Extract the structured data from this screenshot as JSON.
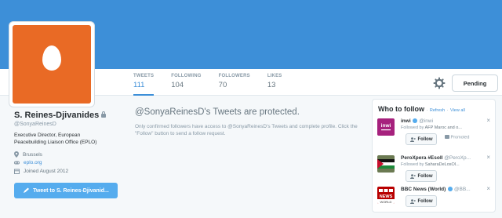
{
  "profile": {
    "name": "S. Reines-Djivanides",
    "handle": "@SonyaReinesD",
    "bio": "Executive Director, European Peacebuilding Liaison Office (EPLO)",
    "location": "Brussels",
    "website": "eplo.org",
    "joined": "Joined August 2012",
    "tweet_button": "Tweet to S. Reines-Djivanid...",
    "avatar_color": "#e96a25"
  },
  "stats": [
    {
      "label": "TWEETS",
      "value": "111"
    },
    {
      "label": "FOLLOWING",
      "value": "104"
    },
    {
      "label": "FOLLOWERS",
      "value": "70"
    },
    {
      "label": "LIKES",
      "value": "13"
    }
  ],
  "actions": {
    "pending_label": "Pending"
  },
  "protected": {
    "title": "@SonyaReinesD's Tweets are protected.",
    "text": "Only confirmed followers have access to @SonyaReinesD's Tweets and complete profile. Click the \"Follow\" button to send a follow request."
  },
  "who_to_follow": {
    "title": "Who to follow",
    "sep": "·",
    "refresh": "Refresh",
    "view_all": "View all",
    "follow_label": "Follow",
    "close": "×",
    "suggestions": [
      {
        "name": "inwi",
        "handle": "@inwi",
        "context_prefix": "Followed by",
        "context": "AFP Maroc and o...",
        "promoted": "Promoted",
        "pic": "inwi"
      },
      {
        "name": "PeroXpera #Esoll",
        "handle": "@PeroXp...",
        "context_prefix": "Followed by",
        "context": "SaharaDeLosOl...",
        "promoted": "",
        "pic": "flag"
      },
      {
        "name": "BBC News (World)",
        "handle": "@BB...",
        "context_prefix": "",
        "context": "",
        "promoted": "",
        "pic": "bbc"
      }
    ]
  },
  "colors": {
    "banner": "#3d8fd8",
    "accent": "#55acee",
    "link": "#3d8fd8"
  }
}
